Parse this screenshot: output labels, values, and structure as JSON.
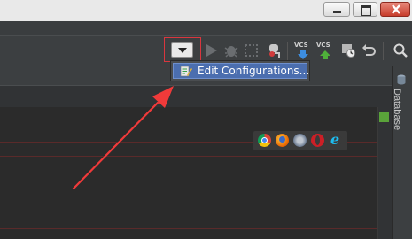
{
  "popup_menu": {
    "edit_configurations_label": "Edit Configurations..."
  },
  "side_panel": {
    "database_tab_label": "Database"
  },
  "toolbar": {
    "vcs_update_label": "VCS",
    "vcs_commit_label": "VCS"
  },
  "colors": {
    "highlight_box": "#d9363e",
    "arrow": "#f03a3a",
    "menu_selection": "#4b6eaf",
    "ide_background": "#2b2b2b"
  }
}
